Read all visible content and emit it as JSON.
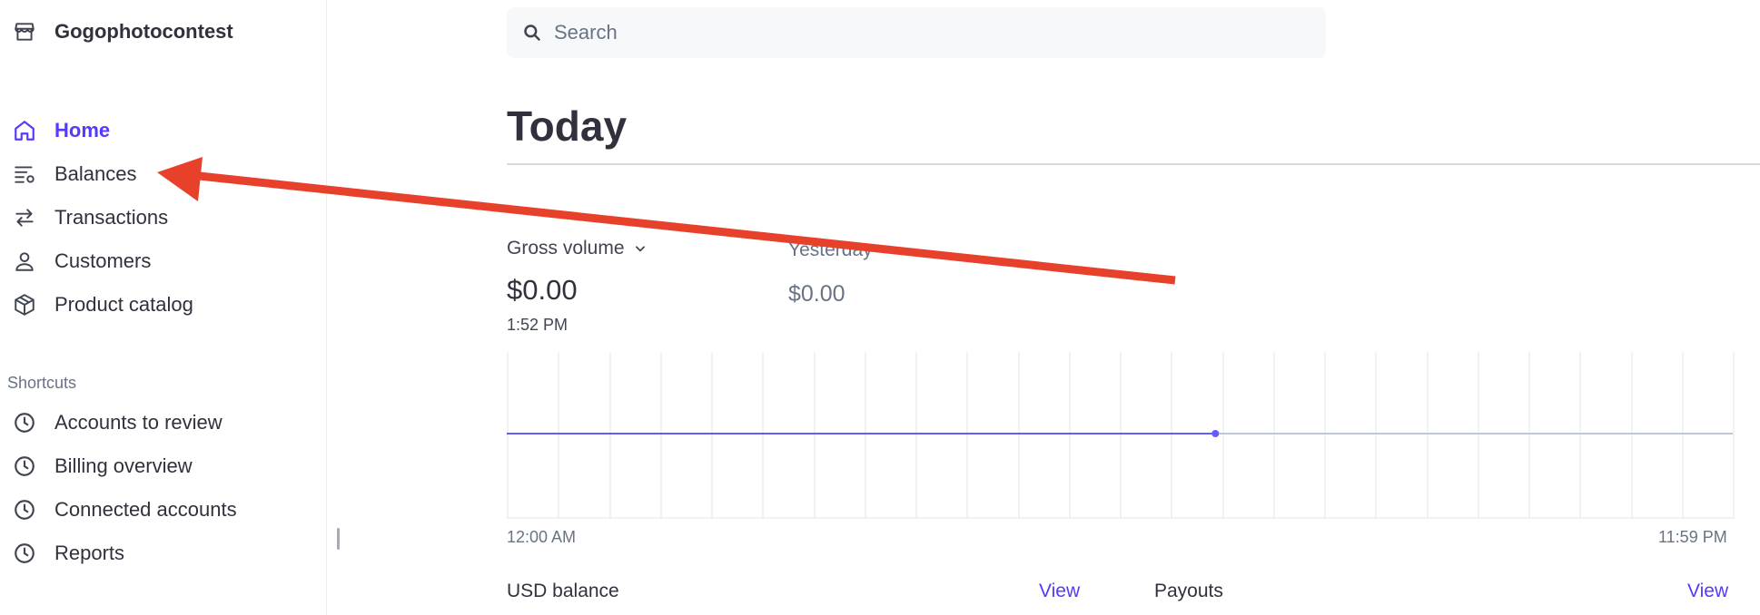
{
  "account": {
    "name": "Gogophotocontest",
    "icon": "store-icon"
  },
  "nav": [
    {
      "label": "Home",
      "icon": "home-icon",
      "active": true
    },
    {
      "label": "Balances",
      "icon": "balances-icon",
      "active": false
    },
    {
      "label": "Transactions",
      "icon": "arrows-swap-icon",
      "active": false
    },
    {
      "label": "Customers",
      "icon": "person-icon",
      "active": false
    },
    {
      "label": "Product catalog",
      "icon": "box-icon",
      "active": false
    }
  ],
  "shortcuts": {
    "label": "Shortcuts",
    "items": [
      {
        "label": "Accounts to review",
        "icon": "clock-icon"
      },
      {
        "label": "Billing overview",
        "icon": "clock-icon"
      },
      {
        "label": "Connected accounts",
        "icon": "clock-icon"
      },
      {
        "label": "Reports",
        "icon": "clock-icon"
      }
    ]
  },
  "search": {
    "placeholder": "Search"
  },
  "page": {
    "title": "Today"
  },
  "metric": {
    "name": "Gross volume",
    "value": "$0.00",
    "time": "1:52 PM",
    "compare_label": "Yesterday",
    "compare_value": "$0.00"
  },
  "chart_data": {
    "type": "line",
    "x_start_label": "12:00 AM",
    "x_end_label": "11:59 PM",
    "series": [
      {
        "values_today_until_now": 0,
        "color": "#635bff"
      },
      {
        "values_yesterday": 0,
        "color": "#c0c8d2"
      }
    ],
    "current_time_fraction_of_day": 0.578,
    "grid": true
  },
  "balance": {
    "label": "USD balance",
    "view_label": "View"
  },
  "payouts": {
    "label": "Payouts",
    "view_label": "View"
  },
  "colors": {
    "accent": "#533afd",
    "annotation_arrow": "#e8412b",
    "text": "#30313d",
    "muted": "#687385"
  }
}
